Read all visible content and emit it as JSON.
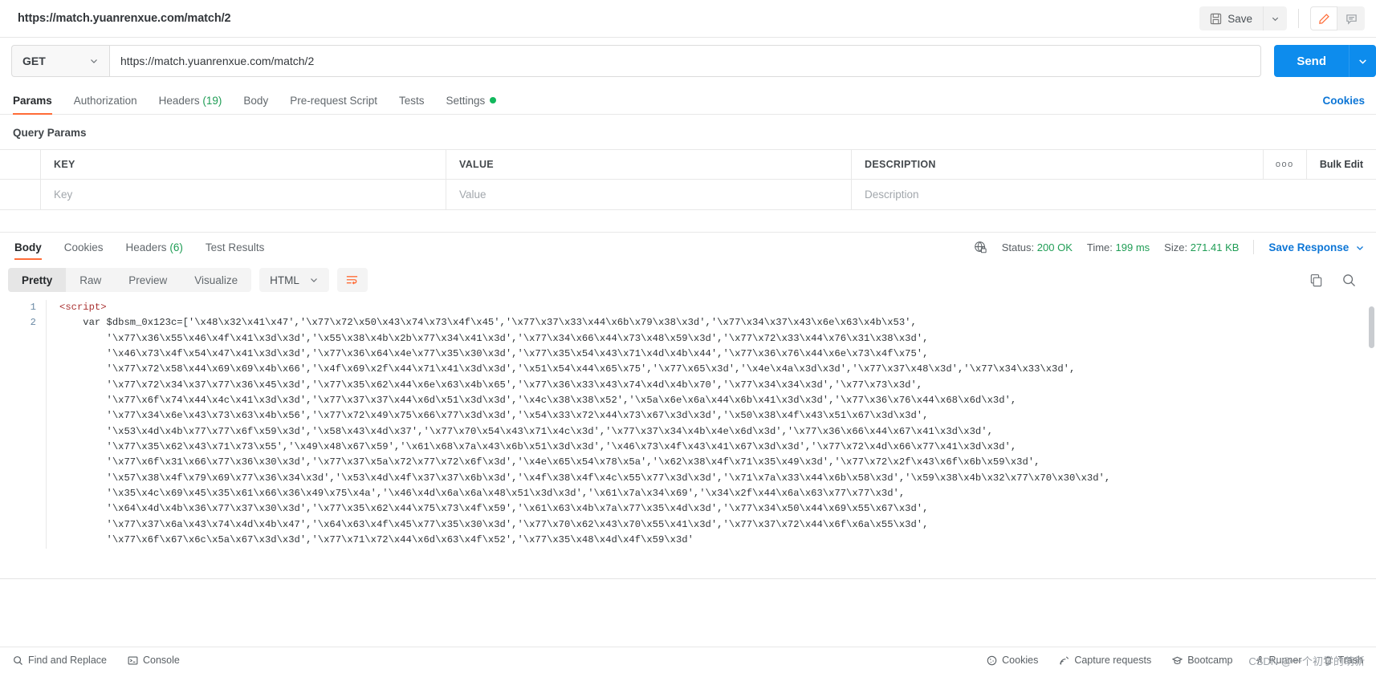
{
  "topbar": {
    "request_title": "https://match.yuanrenxue.com/match/2",
    "save_label": "Save",
    "save_icon": "floppy-disk-icon",
    "caret_icon": "chevron-down-icon",
    "edit_icon": "pencil-icon",
    "comment_icon": "comment-icon"
  },
  "url_row": {
    "method": "GET",
    "method_caret": "chevron-down-icon",
    "url": "https://match.yuanrenxue.com/match/2",
    "send_label": "Send",
    "send_caret": "chevron-down-icon"
  },
  "request_tabs": {
    "items": [
      {
        "label": "Params",
        "active": true
      },
      {
        "label": "Authorization",
        "active": false
      },
      {
        "label": "Headers",
        "count": "(19)",
        "active": false
      },
      {
        "label": "Body",
        "active": false
      },
      {
        "label": "Pre-request Script",
        "active": false
      },
      {
        "label": "Tests",
        "active": false
      },
      {
        "label": "Settings",
        "dot": true,
        "active": false
      }
    ],
    "cookies_link": "Cookies"
  },
  "query_params": {
    "section_title": "Query Params",
    "columns": [
      "KEY",
      "VALUE",
      "DESCRIPTION"
    ],
    "placeholders": {
      "key": "Key",
      "value": "Value",
      "description": "Description"
    },
    "more_icon": "ooo",
    "bulk_edit_label": "Bulk Edit"
  },
  "response": {
    "tabs": [
      {
        "label": "Body",
        "active": true
      },
      {
        "label": "Cookies",
        "active": false
      },
      {
        "label": "Headers",
        "count": "(6)",
        "active": false
      },
      {
        "label": "Test Results",
        "active": false
      }
    ],
    "globe_icon": "globe-lock-icon",
    "status_label": "Status:",
    "status_value": "200 OK",
    "time_label": "Time:",
    "time_value": "199 ms",
    "size_label": "Size:",
    "size_value": "271.41 KB",
    "save_response_label": "Save Response",
    "save_response_caret": "chevron-down-icon"
  },
  "view_toolbar": {
    "modes": [
      {
        "label": "Pretty",
        "active": true
      },
      {
        "label": "Raw",
        "active": false
      },
      {
        "label": "Preview",
        "active": false
      },
      {
        "label": "Visualize",
        "active": false
      }
    ],
    "format": "HTML",
    "format_caret": "chevron-down-icon",
    "wrap_icon": "word-wrap-icon",
    "copy_icon": "copy-icon",
    "search_icon": "search-icon"
  },
  "code": {
    "line_numbers": [
      "1",
      "2"
    ],
    "line1": "<script>",
    "lines": [
      "    var $dbsm_0x123c=['\\x48\\x32\\x41\\x47','\\x77\\x72\\x50\\x43\\x74\\x73\\x4f\\x45','\\x77\\x37\\x33\\x44\\x6b\\x79\\x38\\x3d','\\x77\\x34\\x37\\x43\\x6e\\x63\\x4b\\x53',",
      "        '\\x77\\x36\\x55\\x46\\x4f\\x41\\x3d\\x3d','\\x55\\x38\\x4b\\x2b\\x77\\x34\\x41\\x3d','\\x77\\x34\\x66\\x44\\x73\\x48\\x59\\x3d','\\x77\\x72\\x33\\x44\\x76\\x31\\x38\\x3d',",
      "        '\\x46\\x73\\x4f\\x54\\x47\\x41\\x3d\\x3d','\\x77\\x36\\x64\\x4e\\x77\\x35\\x30\\x3d','\\x77\\x35\\x54\\x43\\x71\\x4d\\x4b\\x44','\\x77\\x36\\x76\\x44\\x6e\\x73\\x4f\\x75',",
      "        '\\x77\\x72\\x58\\x44\\x69\\x69\\x4b\\x66','\\x4f\\x69\\x2f\\x44\\x71\\x41\\x3d\\x3d','\\x51\\x54\\x44\\x65\\x75','\\x77\\x65\\x3d','\\x4e\\x4a\\x3d\\x3d','\\x77\\x37\\x48\\x3d','\\x77\\x34\\x33\\x3d',",
      "        '\\x77\\x72\\x34\\x37\\x77\\x36\\x45\\x3d','\\x77\\x35\\x62\\x44\\x6e\\x63\\x4b\\x65','\\x77\\x36\\x33\\x43\\x74\\x4d\\x4b\\x70','\\x77\\x34\\x34\\x3d','\\x77\\x73\\x3d',",
      "        '\\x77\\x6f\\x74\\x44\\x4c\\x41\\x3d\\x3d','\\x77\\x37\\x37\\x44\\x6d\\x51\\x3d\\x3d','\\x4c\\x38\\x38\\x52','\\x5a\\x6e\\x6a\\x44\\x6b\\x41\\x3d\\x3d','\\x77\\x36\\x76\\x44\\x68\\x6d\\x3d',",
      "        '\\x77\\x34\\x6e\\x43\\x73\\x63\\x4b\\x56','\\x77\\x72\\x49\\x75\\x66\\x77\\x3d\\x3d','\\x54\\x33\\x72\\x44\\x73\\x67\\x3d\\x3d','\\x50\\x38\\x4f\\x43\\x51\\x67\\x3d\\x3d',",
      "        '\\x53\\x4d\\x4b\\x77\\x77\\x6f\\x59\\x3d','\\x58\\x43\\x4d\\x37','\\x77\\x70\\x54\\x43\\x71\\x4c\\x3d','\\x77\\x37\\x34\\x4b\\x4e\\x6d\\x3d','\\x77\\x36\\x66\\x44\\x67\\x41\\x3d\\x3d',",
      "        '\\x77\\x35\\x62\\x43\\x71\\x73\\x55','\\x49\\x48\\x67\\x59','\\x61\\x68\\x7a\\x43\\x6b\\x51\\x3d\\x3d','\\x46\\x73\\x4f\\x43\\x41\\x67\\x3d\\x3d','\\x77\\x72\\x4d\\x66\\x77\\x41\\x3d\\x3d',",
      "        '\\x77\\x6f\\x31\\x66\\x77\\x36\\x30\\x3d','\\x77\\x37\\x5a\\x72\\x77\\x72\\x6f\\x3d','\\x4e\\x65\\x54\\x78\\x5a','\\x62\\x38\\x4f\\x71\\x35\\x49\\x3d','\\x77\\x72\\x2f\\x43\\x6f\\x6b\\x59\\x3d',",
      "        '\\x57\\x38\\x4f\\x79\\x69\\x77\\x36\\x34\\x3d','\\x53\\x4d\\x4f\\x37\\x37\\x6b\\x3d','\\x4f\\x38\\x4f\\x4c\\x55\\x77\\x3d\\x3d','\\x71\\x7a\\x33\\x44\\x6b\\x58\\x3d','\\x59\\x38\\x4b\\x32\\x77\\x70\\x30\\x3d',",
      "        '\\x35\\x4c\\x69\\x45\\x35\\x61\\x66\\x36\\x49\\x75\\x4a','\\x46\\x4d\\x6a\\x6a\\x48\\x51\\x3d\\x3d','\\x61\\x7a\\x34\\x69','\\x34\\x2f\\x44\\x6a\\x63\\x77\\x77\\x3d',",
      "        '\\x64\\x4d\\x4b\\x36\\x77\\x37\\x30\\x3d','\\x77\\x35\\x62\\x44\\x75\\x73\\x4f\\x59','\\x61\\x63\\x4b\\x7a\\x77\\x35\\x4d\\x3d','\\x77\\x34\\x50\\x44\\x69\\x55\\x67\\x3d',",
      "        '\\x77\\x37\\x6a\\x43\\x74\\x4d\\x4b\\x47','\\x64\\x63\\x4f\\x45\\x77\\x35\\x30\\x3d','\\x77\\x70\\x62\\x43\\x70\\x55\\x41\\x3d','\\x77\\x37\\x72\\x44\\x6f\\x6a\\x55\\x3d',",
      "        '\\x77\\x6f\\x67\\x6c\\x5a\\x67\\x3d\\x3d','\\x77\\x71\\x72\\x44\\x6d\\x63\\x4f\\x52','\\x77\\x35\\x48\\x4d\\x4f\\x59\\x3d'"
    ]
  },
  "footer": {
    "left_items": [
      {
        "label": "Find and Replace",
        "icon": "search-icon"
      },
      {
        "label": "Console",
        "icon": "console-icon"
      }
    ],
    "right_items": [
      {
        "label": "Cookies",
        "icon": "cookie-icon"
      },
      {
        "label": "Capture requests",
        "icon": "satellite-icon"
      },
      {
        "label": "Bootcamp",
        "icon": "graduation-icon"
      },
      {
        "label": "Runner",
        "icon": "runner-icon"
      },
      {
        "label": "Trash",
        "icon": "trash-icon"
      }
    ]
  },
  "watermark": "CSDN @一个初学的萌新",
  "colors": {
    "accent": "#ff6c37",
    "send_blue": "#0d8ced",
    "link_blue": "#0d76d6",
    "success_green": "#1f9d55"
  }
}
